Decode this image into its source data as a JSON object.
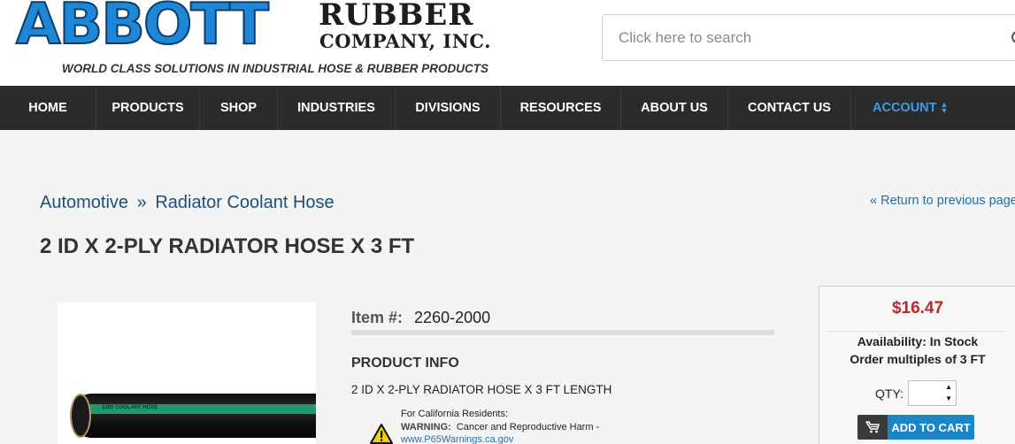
{
  "logo": {
    "main": "ABBOTT",
    "sub1": "RUBBER",
    "sub2": "COMPANY, INC.",
    "tagline": "WORLD CLASS SOLUTIONS IN INDUSTRIAL HOSE & RUBBER PRODUCTS",
    "colors": {
      "blue": "#1e88d6",
      "outline": "#0d3d6e"
    }
  },
  "search": {
    "placeholder": "Click here to search"
  },
  "nav": {
    "items": [
      {
        "label": "HOME"
      },
      {
        "label": "PRODUCTS"
      },
      {
        "label": "SHOP"
      },
      {
        "label": "INDUSTRIES"
      },
      {
        "label": "DIVISIONS"
      },
      {
        "label": "RESOURCES"
      },
      {
        "label": "ABOUT US"
      },
      {
        "label": "CONTACT US"
      },
      {
        "label": "ACCOUNT"
      }
    ],
    "accent": "#3d9be9"
  },
  "breadcrumb": {
    "category": "Automotive",
    "separator": "»",
    "subcategory": "Radiator Coolant Hose"
  },
  "return_link": "« Return to previous page",
  "product": {
    "title": "2 ID X 2-PLY RADIATOR HOSE X 3 FT",
    "item_label": "Item #:",
    "item_number": "2260-2000",
    "info_heading": "PRODUCT INFO",
    "info_text": "2 ID X 2-PLY RADIATOR HOSE X 3 FT LENGTH",
    "image_icon": "coolant-hose-image",
    "hose_print": "2260 COOLANT HOSE"
  },
  "prop65": {
    "residents": "For California Residents:",
    "warning_label": "WARNING:",
    "warning_text": "Cancer and Reproductive Harm -",
    "link": "www.P65Warnings.ca.gov"
  },
  "buy_box": {
    "price": "$16.47",
    "availability": "Availability: In Stock",
    "multiples": "Order multiples of 3 FT",
    "qty_label": "QTY:",
    "qty_value": "",
    "add_to_cart": "ADD TO CART",
    "price_color": "#c0262a",
    "button_color": "#1a85c8"
  }
}
